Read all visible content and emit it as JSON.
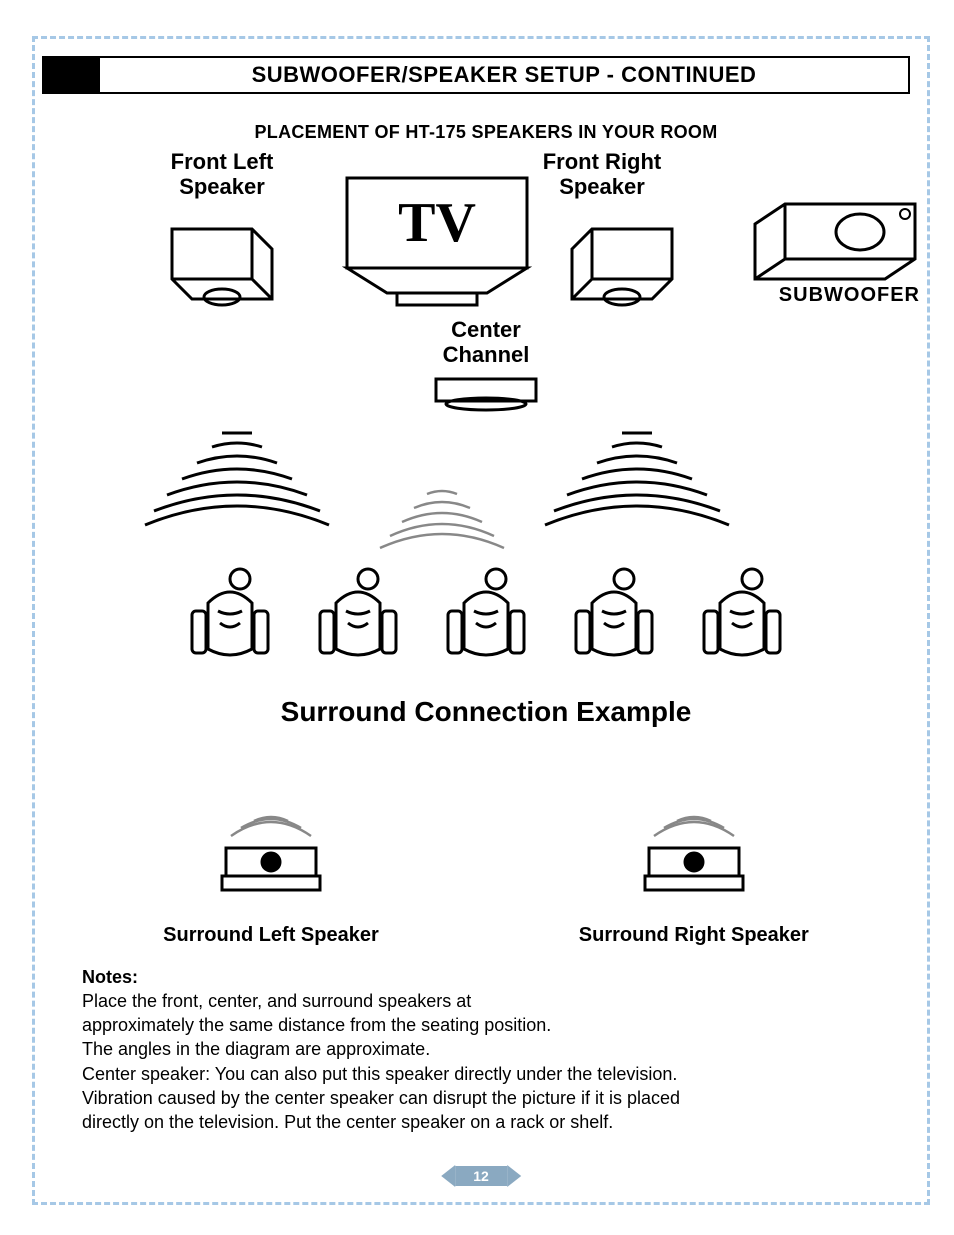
{
  "section_title": "SUBWOOFER/SPEAKER SETUP - CONTINUED",
  "placement_title": "PLACEMENT OF HT-175 SPEAKERS IN YOUR ROOM",
  "labels": {
    "front_left": "Front Left Speaker",
    "front_right": "Front Right Speaker",
    "center_channel": "Center Channel",
    "subwoofer": "SUBWOOFER",
    "tv": "TV"
  },
  "surround_title": "Surround Connection Example",
  "surround_labels": {
    "left": "Surround Left Speaker",
    "right": "Surround Right Speaker"
  },
  "notes": {
    "heading": "Notes:",
    "lines": [
      "Place the front, center, and surround speakers at",
      "approximately the same distance from the seating position.",
      "The angles in the diagram are approximate.",
      "Center speaker: You can also put this speaker directly under the television.",
      "Vibration caused by the center speaker can disrupt the picture if it is placed",
      "directly on the television. Put the center speaker on a rack or shelf."
    ]
  },
  "page_number": "12"
}
